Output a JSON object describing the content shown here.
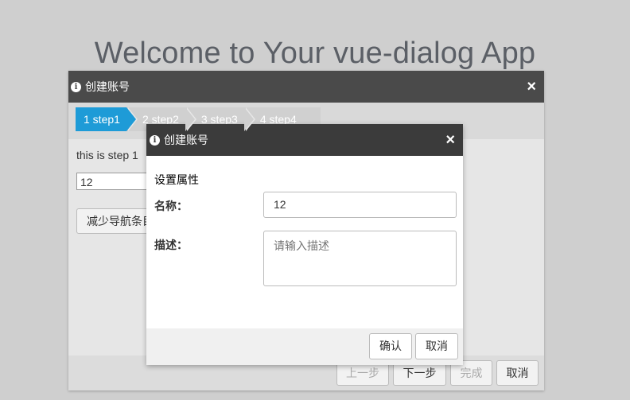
{
  "app": {
    "title": "Welcome to Your vue-dialog App"
  },
  "outer_dialog": {
    "title": "创建账号",
    "close_label": "×",
    "steps": [
      {
        "label": "1 step1",
        "active": true
      },
      {
        "label": "2 step2",
        "active": false
      },
      {
        "label": "3 step3",
        "active": false
      },
      {
        "label": "4 step4",
        "active": false
      }
    ],
    "body_text": "this is step 1",
    "input_value": "12",
    "reduce_button": "减少导航条目",
    "footer": {
      "prev": "上一步",
      "next": "下一步",
      "finish": "完成",
      "cancel": "取消"
    }
  },
  "inner_dialog": {
    "title": "创建账号",
    "close_label": "×",
    "section_label": "设置属性",
    "name_label": "名称：",
    "name_value": "12",
    "desc_label": "描述：",
    "desc_placeholder": "请输入描述",
    "confirm": "确认",
    "cancel": "取消"
  },
  "colors": {
    "background": "#cfcfcf",
    "header": "#4a4a4a",
    "step_active": "#1e9bd7",
    "step_inactive": "#d0d0d0"
  }
}
